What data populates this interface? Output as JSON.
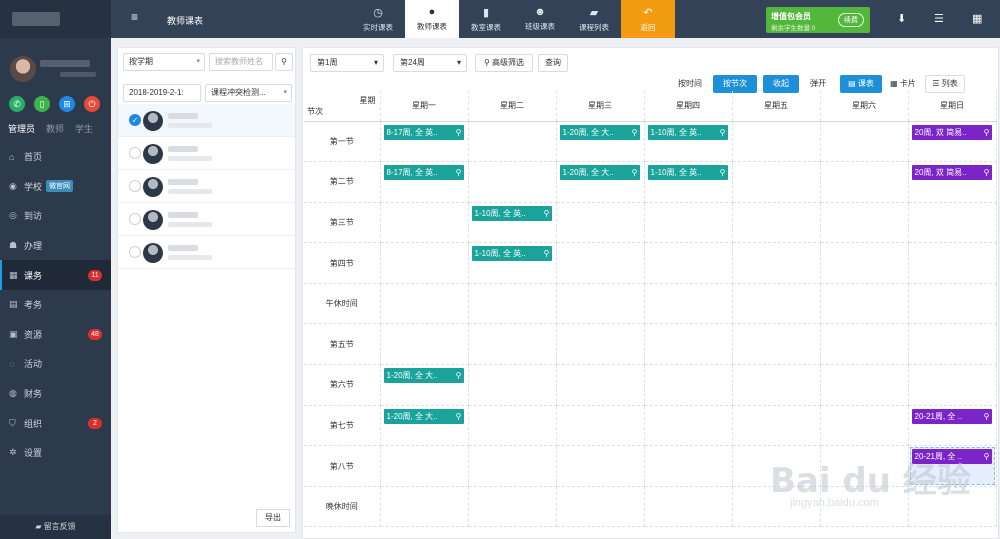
{
  "sidebar": {
    "roles": [
      "管理员",
      "教师",
      "学生"
    ],
    "menu": [
      {
        "label": "首页",
        "icon": "home-icon",
        "glyph": "⌂"
      },
      {
        "label": "学校",
        "icon": "school-icon",
        "glyph": "◉",
        "tag": "微官网"
      },
      {
        "label": "到访",
        "icon": "eye-icon",
        "glyph": "◎"
      },
      {
        "label": "办理",
        "icon": "users-icon",
        "glyph": "☗"
      },
      {
        "label": "课务",
        "icon": "calendar-icon",
        "glyph": "▦",
        "badge": "11",
        "active": true
      },
      {
        "label": "考务",
        "icon": "exam-icon",
        "glyph": "▤"
      },
      {
        "label": "资源",
        "icon": "resource-icon",
        "glyph": "▣",
        "badge": "48"
      },
      {
        "label": "活动",
        "icon": "activity-icon",
        "glyph": "◌"
      },
      {
        "label": "财务",
        "icon": "finance-icon",
        "glyph": "◍"
      },
      {
        "label": "组织",
        "icon": "graduation-icon",
        "glyph": "⛉",
        "badge": "2"
      },
      {
        "label": "设置",
        "icon": "settings-icon",
        "glyph": "✲"
      }
    ],
    "feedback": "留言反馈"
  },
  "topbar": {
    "page_title": "教师课表",
    "tabs": [
      {
        "label": "实时课表",
        "icon": "clock-icon",
        "glyph": "◷"
      },
      {
        "label": "教师课表",
        "icon": "user-icon",
        "glyph": "●",
        "active": true
      },
      {
        "label": "教室课表",
        "icon": "room-icon",
        "glyph": "▮"
      },
      {
        "label": "班级课表",
        "icon": "group-icon",
        "glyph": "☻"
      },
      {
        "label": "课程列表",
        "icon": "book-icon",
        "glyph": "▰"
      },
      {
        "label": "返回",
        "icon": "back-icon",
        "glyph": "↶",
        "return": true
      }
    ],
    "vip": {
      "title": "增值包会员",
      "subtitle": "剩余学生数量 0",
      "button": "续费"
    }
  },
  "teacher_panel": {
    "term_select": "按学期",
    "search_placeholder": "搜索教师姓名",
    "term_value": "2018-2019-2-1:",
    "conflict_select": "课程冲突检测...",
    "export": "导出"
  },
  "schedule": {
    "week_start": "第1周",
    "week_end": "第24周",
    "advanced_filter": "高级筛选",
    "query": "查询",
    "by_time": "按时间",
    "by_period": "按节次",
    "collapse": "收起",
    "expand": "弹开",
    "view_table": "课表",
    "view_card": "卡片",
    "view_list": "列表",
    "corner_day": "星期",
    "corner_period": "节次",
    "days": [
      "星期一",
      "星期二",
      "星期三",
      "星期四",
      "星期五",
      "星期六",
      "星期日"
    ],
    "rows": [
      {
        "label": "第一节",
        "cells": [
          {
            "text": "8-17周, 全 英..",
            "color": "teal"
          },
          null,
          {
            "text": "1-20周, 全 大..",
            "color": "teal"
          },
          {
            "text": "1-10周, 全 英..",
            "color": "teal"
          },
          null,
          null,
          {
            "text": "20周, 双 简易..",
            "color": "purple"
          }
        ]
      },
      {
        "label": "第二节",
        "cells": [
          {
            "text": "8-17周, 全 英..",
            "color": "teal"
          },
          null,
          {
            "text": "1-20周, 全 大..",
            "color": "teal"
          },
          {
            "text": "1-10周, 全 英..",
            "color": "teal"
          },
          null,
          null,
          {
            "text": "20周, 双 简易..",
            "color": "purple"
          }
        ]
      },
      {
        "label": "第三节",
        "cells": [
          null,
          {
            "text": "1-10周, 全 英..",
            "color": "teal"
          },
          null,
          null,
          null,
          null,
          null
        ]
      },
      {
        "label": "第四节",
        "cells": [
          null,
          {
            "text": "1-10周, 全 英..",
            "color": "teal"
          },
          null,
          null,
          null,
          null,
          null
        ]
      },
      {
        "label": "午休时间",
        "cells": [
          null,
          null,
          null,
          null,
          null,
          null,
          null
        ]
      },
      {
        "label": "第五节",
        "cells": [
          null,
          null,
          null,
          null,
          null,
          null,
          null
        ]
      },
      {
        "label": "第六节",
        "cells": [
          {
            "text": "1-20周, 全 大..",
            "color": "teal"
          },
          null,
          null,
          null,
          null,
          null,
          null
        ]
      },
      {
        "label": "第七节",
        "cells": [
          {
            "text": "1-20周, 全 大..",
            "color": "teal"
          },
          null,
          null,
          null,
          null,
          null,
          {
            "text": "20-21周, 全 ..",
            "color": "purple"
          }
        ]
      },
      {
        "label": "第八节",
        "cells": [
          null,
          null,
          null,
          null,
          null,
          null,
          {
            "text": "20-21周, 全 ..",
            "color": "purple",
            "selected": true
          }
        ]
      },
      {
        "label": "晚休时间",
        "cells": [
          null,
          null,
          null,
          null,
          null,
          null,
          null
        ]
      }
    ]
  },
  "watermark": {
    "big": "Bai du 经验",
    "small": "jingyan.baidu.com"
  }
}
